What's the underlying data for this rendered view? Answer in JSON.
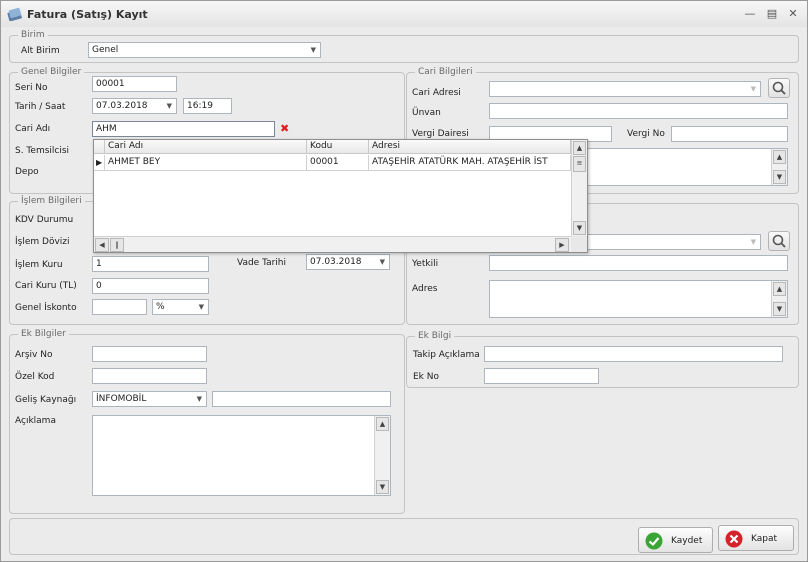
{
  "window": {
    "title": "Fatura (Satış) Kayıt"
  },
  "birim": {
    "group_title": "Birim",
    "alt_birim_label": "Alt Birim",
    "alt_birim_value": "Genel"
  },
  "genel": {
    "group_title": "Genel Bilgiler",
    "seri_no_label": "Seri No",
    "seri_no_value": "00001",
    "tarih_label": "Tarih / Saat",
    "tarih_value": "07.03.2018",
    "saat_value": "16:19",
    "cari_adi_label": "Cari Adı",
    "cari_adi_value": "AHM",
    "temsilci_label": "S. Temsilcisi",
    "depo_label": "Depo"
  },
  "lookup_grid": {
    "columns": [
      "Cari Adı",
      "Kodu",
      "Adresi"
    ],
    "rows": [
      {
        "cari_adi": "AHMET BEY",
        "kodu": "00001",
        "adresi": "ATAŞEHİR ATATÜRK MAH.  ATAŞEHİR İST"
      }
    ]
  },
  "islem": {
    "group_title": "İşlem Bilgileri",
    "kdv_label": "KDV Durumu",
    "doviz_label": "İşlem Dövizi",
    "kur_label": "İşlem Kuru",
    "kur_value": "1",
    "vade_label": "Vade Tarihi",
    "vade_value": "07.03.2018",
    "cari_kur_label": "Cari Kuru  (TL)",
    "cari_kur_value": "0",
    "iskonto_label": "Genel İskonto",
    "iskonto_value": "",
    "iskonto_type": "%"
  },
  "cari": {
    "group_title": "Cari Bilgileri",
    "adres_label": "Cari Adresi",
    "unvan_label": "Ünvan",
    "vergi_dairesi_label": "Vergi Dairesi",
    "vergi_no_label": "Vergi No"
  },
  "teslimat": {
    "yetkili_label": "Yetkili",
    "adres_label": "Adres"
  },
  "ek_bilgiler": {
    "group_title": "Ek Bilgiler",
    "arsiv_label": "Arşiv No",
    "ozel_kod_label": "Özel Kod",
    "gelis_label": "Geliş Kaynağı",
    "gelis_value": "İNFOMOBİL",
    "aciklama_label": "Açıklama"
  },
  "ek_bilgi": {
    "group_title": "Ek Bilgi",
    "takip_label": "Takip Açıklama",
    "ek_no_label": "Ek No"
  },
  "buttons": {
    "save": "Kaydet",
    "close": "Kapat"
  },
  "colors": {
    "save_icon": "#3aa535",
    "close_icon": "#d4232b",
    "clear_icon": "#e02020"
  }
}
